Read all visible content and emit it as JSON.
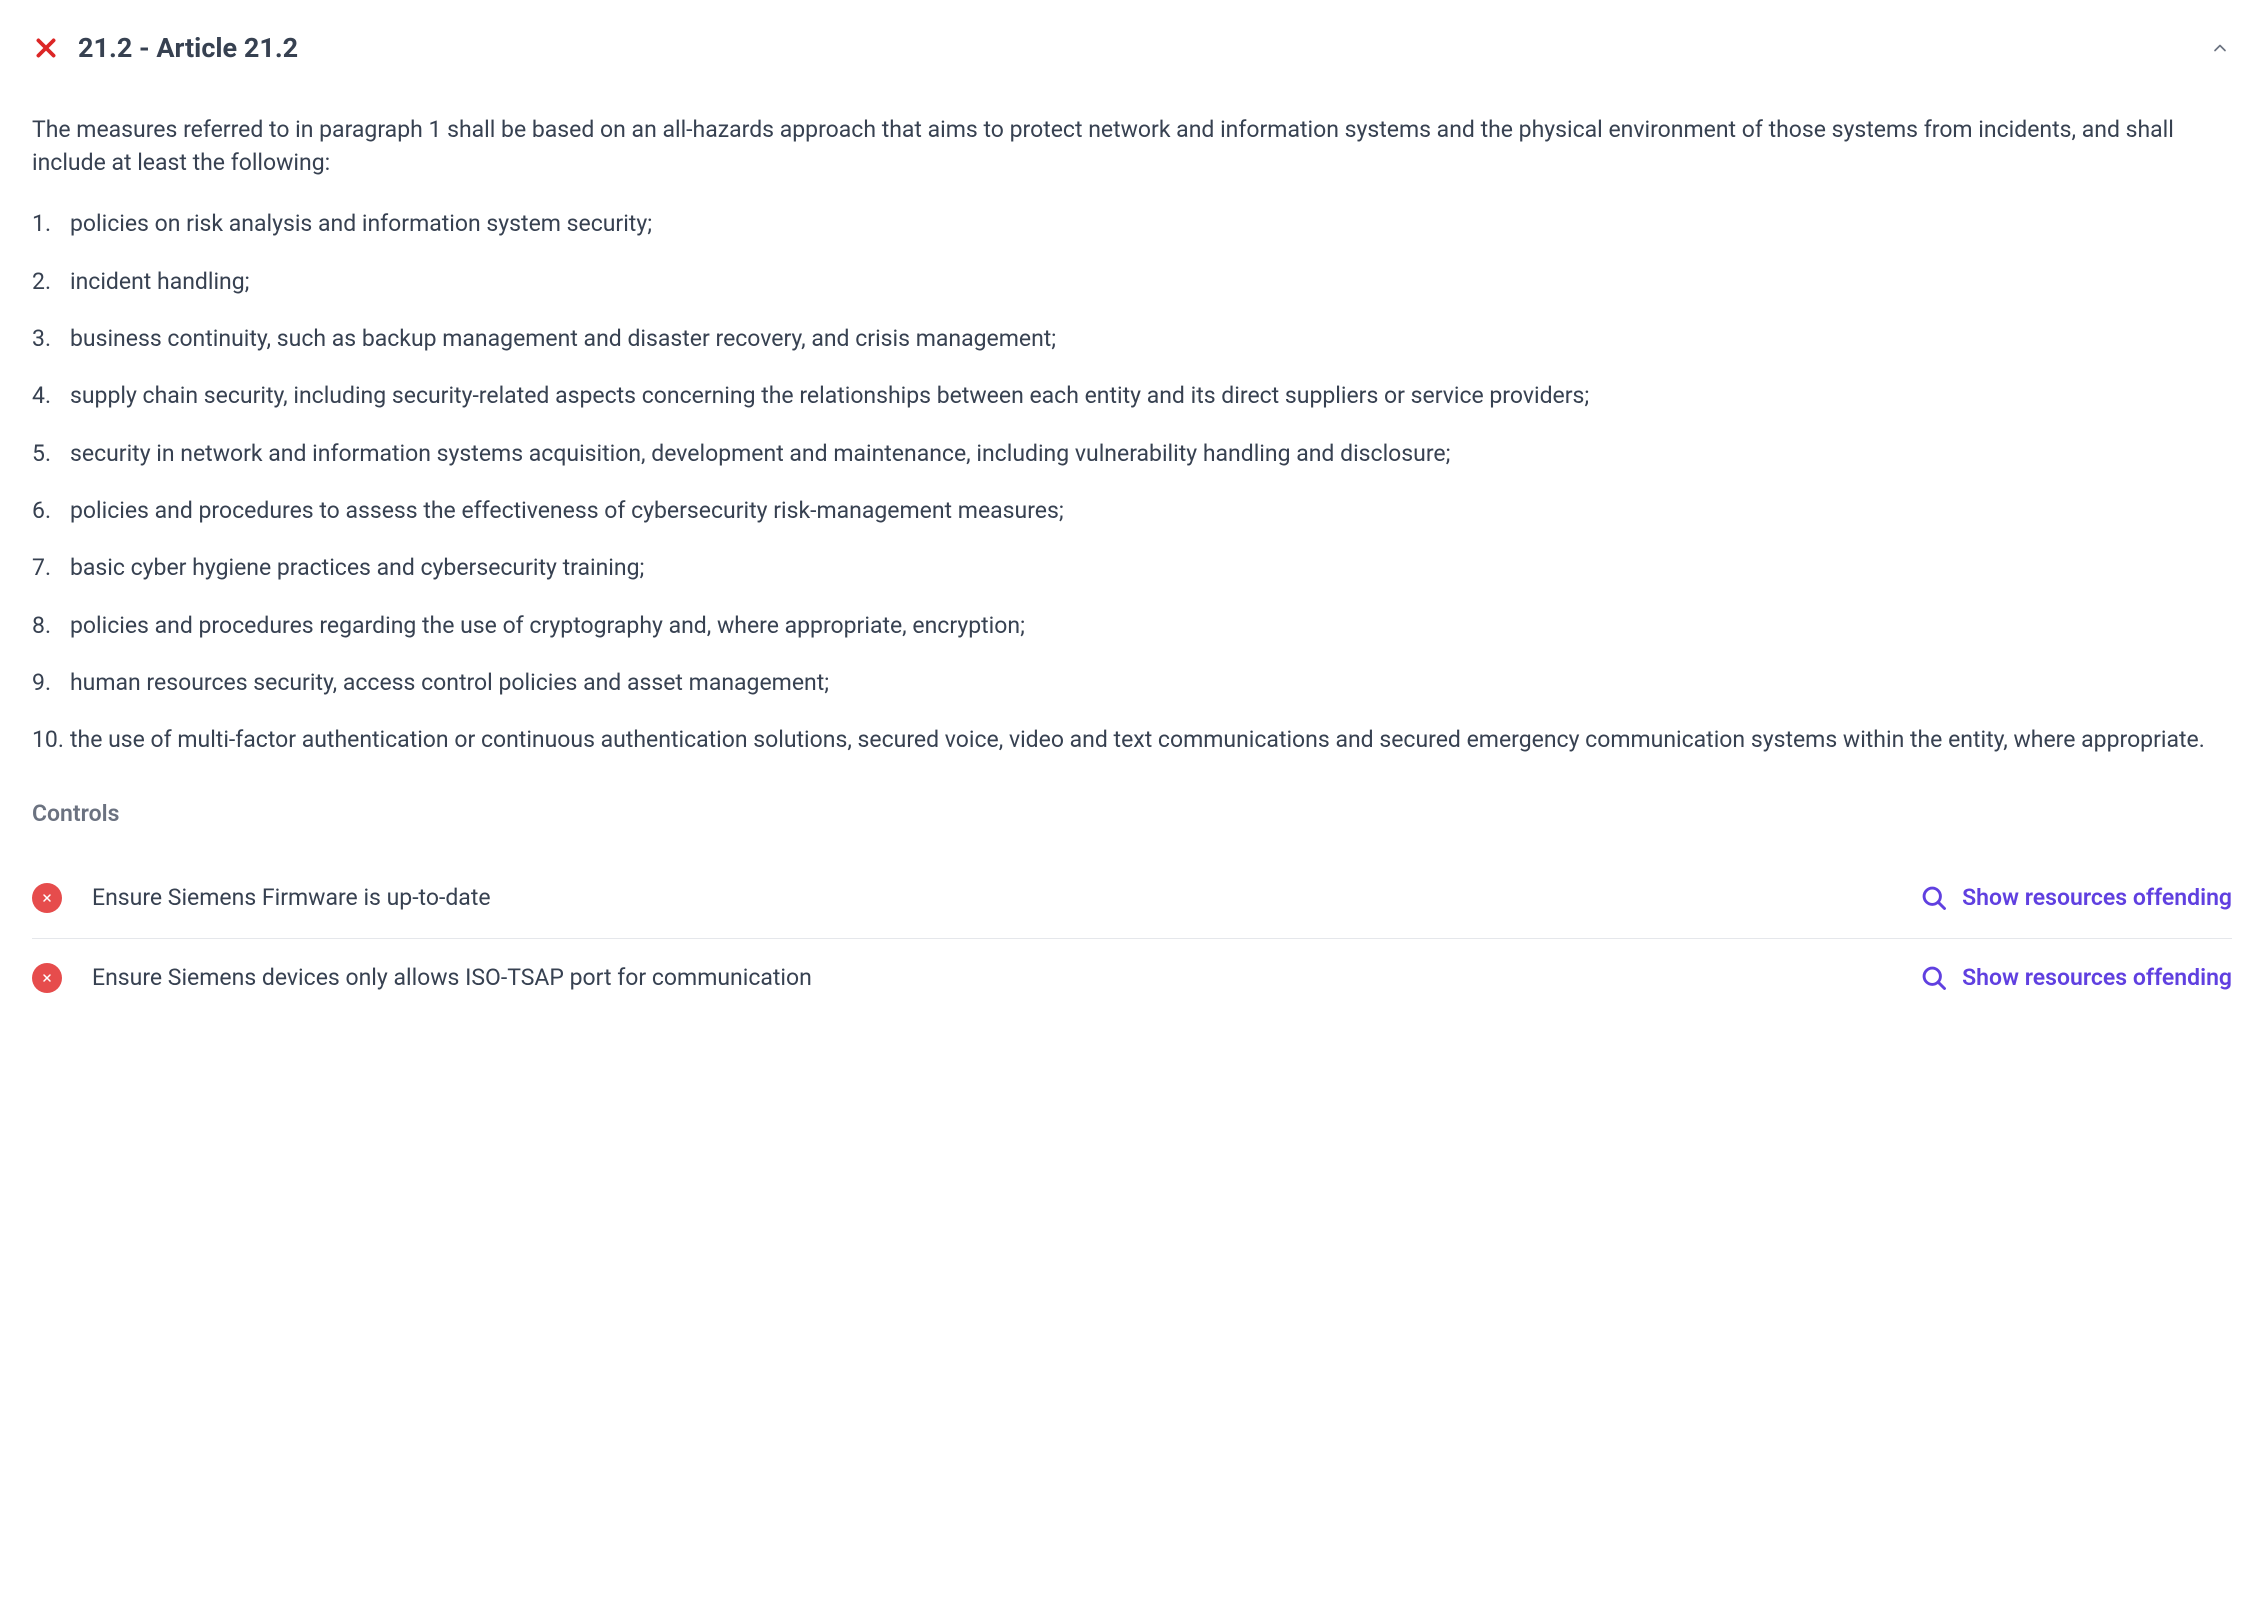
{
  "header": {
    "title": "21.2 - Article 21.2"
  },
  "intro": "The measures referred to in paragraph 1 shall be based on an all-hazards approach that aims to protect network and information systems and the physical environment of those systems from incidents, and shall include at least the following:",
  "measures": [
    "policies on risk analysis and information system security;",
    "incident handling;",
    "business continuity, such as backup management and disaster recovery, and crisis management;",
    "supply chain security, including security-related aspects concerning the relationships between each entity and its direct suppliers or service providers;",
    "security in network and information systems acquisition, development and maintenance, including vulnerability handling and disclosure;",
    "policies and procedures to assess the effectiveness of cybersecurity risk-management measures;",
    "basic cyber hygiene practices and cybersecurity training;",
    "policies and procedures regarding the use of cryptography and, where appropriate, encryption;",
    "human resources security, access control policies and asset management;",
    "the use of multi-factor authentication or continuous authentication solutions, secured voice, video and text communications and secured emergency communication systems within the entity, where appropriate."
  ],
  "controls_label": "Controls",
  "controls": [
    {
      "text": "Ensure Siemens Firmware is up-to-date",
      "action_label": "Show resources offending"
    },
    {
      "text": "Ensure Siemens devices only allows ISO-TSAP port for communication",
      "action_label": "Show resources offending"
    }
  ]
}
